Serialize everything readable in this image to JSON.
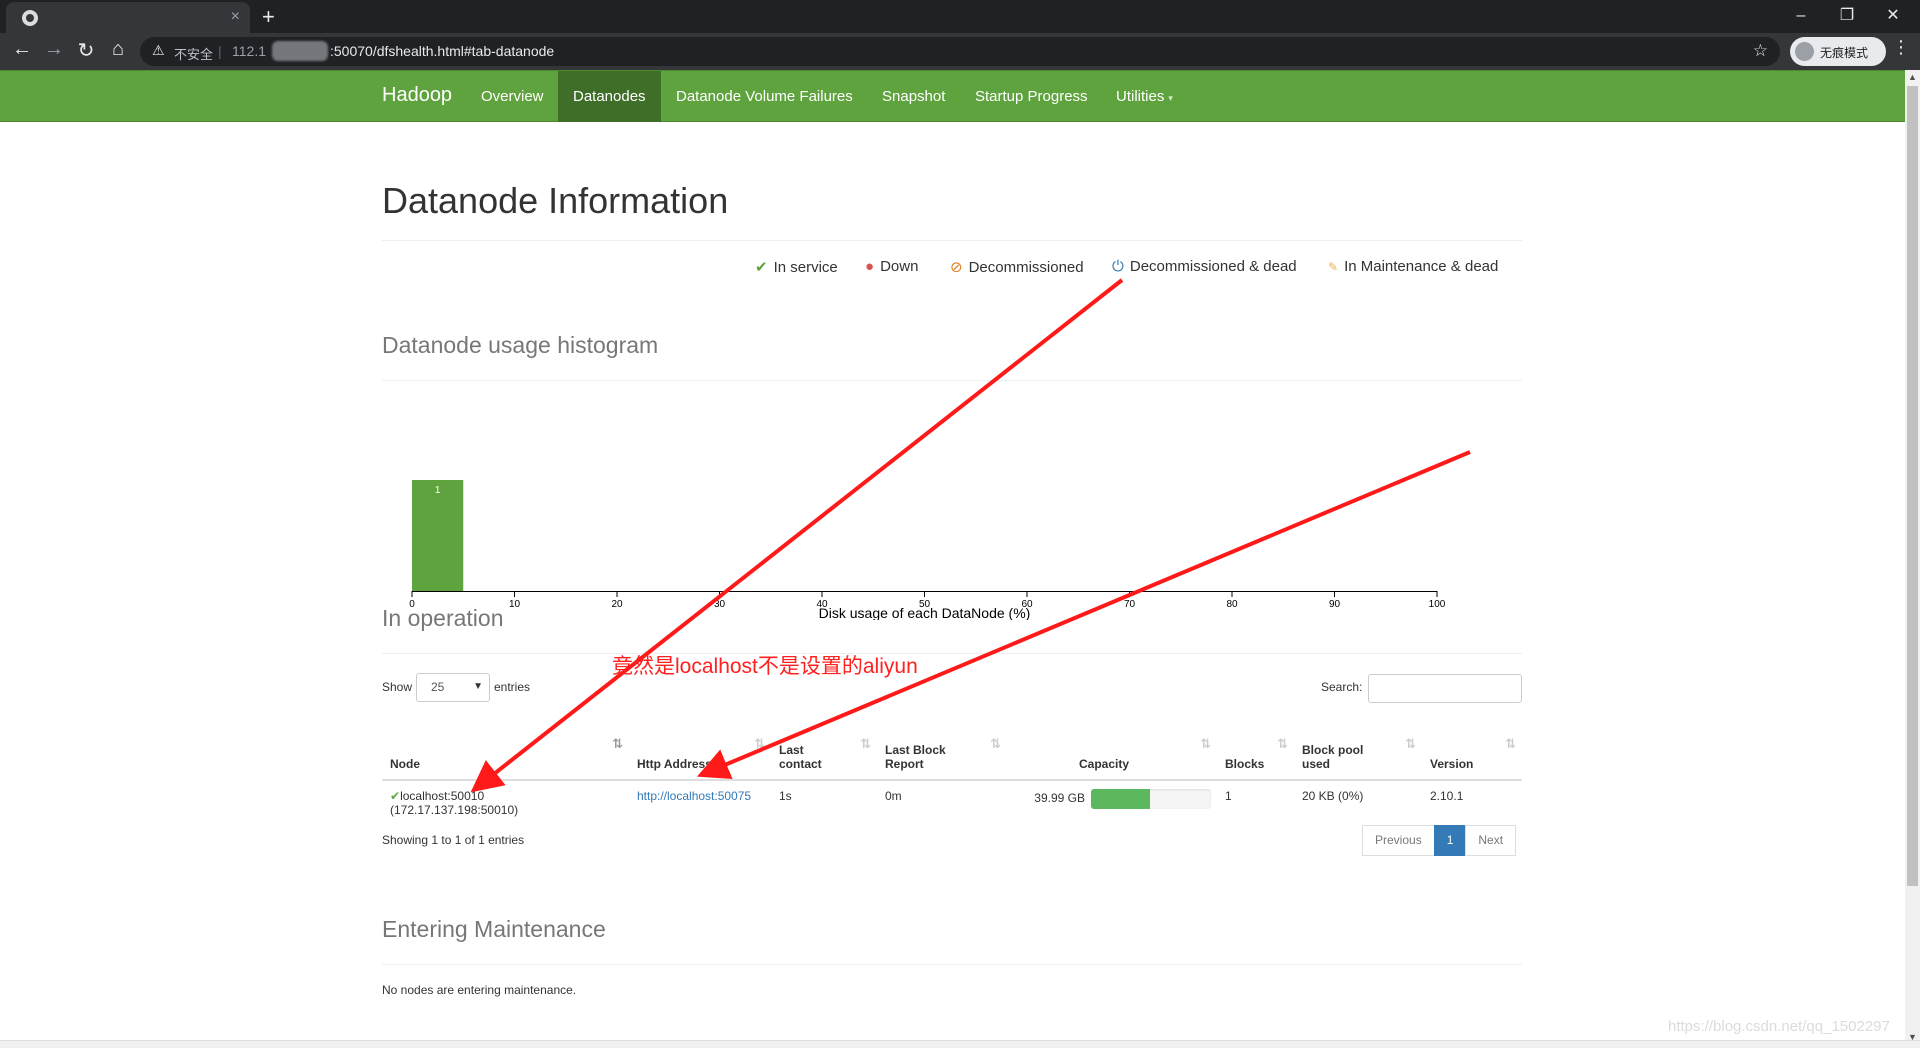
{
  "browser": {
    "tab_close": "×",
    "new_tab": "+",
    "win_min": "–",
    "win_max": "❐",
    "win_close": "✕",
    "insecure_label": "不安全",
    "url_host_prefix": "112.1",
    "url_rest": ":50070/dfshealth.html#tab-datanode",
    "profile_label": "无痕模式"
  },
  "navbar": {
    "brand": "Hadoop",
    "items": [
      {
        "label": "Overview"
      },
      {
        "label": "Datanodes",
        "active": true
      },
      {
        "label": "Datanode Volume Failures"
      },
      {
        "label": "Snapshot"
      },
      {
        "label": "Startup Progress"
      },
      {
        "label": "Utilities",
        "caret": "▾"
      }
    ]
  },
  "page": {
    "title": "Datanode Information",
    "legend": [
      {
        "icon": "check-icon",
        "glyph": "✔",
        "color": "#5fa33e",
        "label": "In service"
      },
      {
        "icon": "down-icon",
        "glyph": "●",
        "color": "#d9534f",
        "label": "Down"
      },
      {
        "icon": "decommissioned-icon",
        "glyph": "⊘",
        "color": "#e07b1f",
        "label": "Decommissioned"
      },
      {
        "icon": "power-icon",
        "glyph": "⏻",
        "color": "#337ab7",
        "label": "Decommissioned & dead"
      },
      {
        "icon": "wrench-icon",
        "glyph": "🔧",
        "color": "#f0ad4e",
        "label": "In Maintenance & dead"
      }
    ],
    "histogram_title": "Datanode usage histogram",
    "operation_title": "In operation",
    "maintenance_title": "Entering Maintenance",
    "maintenance_text": "No nodes are entering maintenance."
  },
  "chart_data": {
    "type": "bar",
    "xlabel": "Disk usage of each DataNode (%)",
    "ticks": [
      0,
      10,
      20,
      30,
      40,
      50,
      60,
      70,
      80,
      90,
      100
    ],
    "xlim": [
      0,
      100
    ],
    "bins": [
      {
        "from": 0,
        "to": 5,
        "count": 1
      }
    ]
  },
  "table": {
    "show_label": "Show",
    "length_value": "25",
    "entries_label": "entries",
    "search_label": "Search:",
    "columns": [
      "Node",
      "Http Address",
      "Last contact",
      "Last Block Report",
      "Capacity",
      "Blocks",
      "Block pool used",
      "Version"
    ],
    "column_parts": {
      "contact": [
        "Last",
        "contact"
      ],
      "report": [
        "Last Block",
        "Report"
      ],
      "pool": [
        "Block pool",
        "used"
      ]
    },
    "row": {
      "status_glyph": "✔",
      "node": "localhost:50010",
      "node_ip": "(172.17.137.198:50010)",
      "http": "http://localhost:50075",
      "last_contact": "1s",
      "last_block_report": "0m",
      "capacity": "39.99 GB",
      "capacity_used_fraction": 0.49,
      "blocks": "1",
      "block_pool_used": "20 KB (0%)",
      "version": "2.10.1"
    },
    "info": "Showing 1 to 1 of 1 entries",
    "pager": {
      "previous": "Previous",
      "current": "1",
      "next": "Next"
    }
  },
  "annotation": "竟然是localhost不是设置的aliyun",
  "watermark": "https://blog.csdn.net/qq_1502297"
}
